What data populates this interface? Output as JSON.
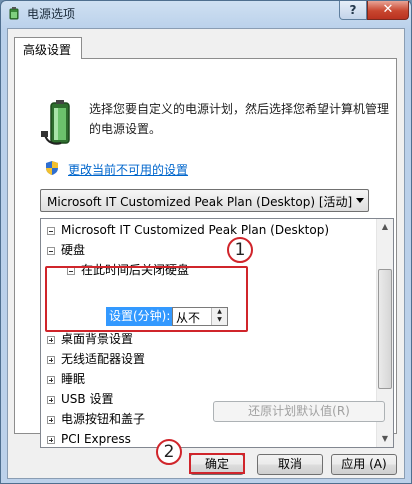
{
  "window": {
    "title": "电源选项",
    "help_label": "?",
    "close_label": "✕"
  },
  "tab": {
    "label": "高级设置"
  },
  "description": "选择您要自定义的电源计划，然后选择您希望计算机管理的电源设置。",
  "link": {
    "label": "更改当前不可用的设置"
  },
  "plan_select": {
    "value": "Microsoft IT Customized Peak Plan (Desktop) [活动]"
  },
  "tree": {
    "root": "Microsoft IT Customized Peak Plan (Desktop)",
    "harddisk": "硬盘",
    "harddisk_off": "在此时间后关闭硬盘",
    "setting_label": "设置(分钟):",
    "setting_value": "从不",
    "items": [
      "桌面背景设置",
      "无线适配器设置",
      "睡眠",
      "USB 设置",
      "电源按钮和盖子",
      "PCI Express"
    ]
  },
  "buttons": {
    "restore": "还原计划默认值(R)",
    "ok": "确定",
    "cancel": "取消",
    "apply": "应用 (A)"
  },
  "callouts": [
    "1",
    "2"
  ],
  "colors": {
    "highlight_red": "#d0252b",
    "selection_blue": "#3399ff",
    "link_blue": "#0066cc"
  }
}
